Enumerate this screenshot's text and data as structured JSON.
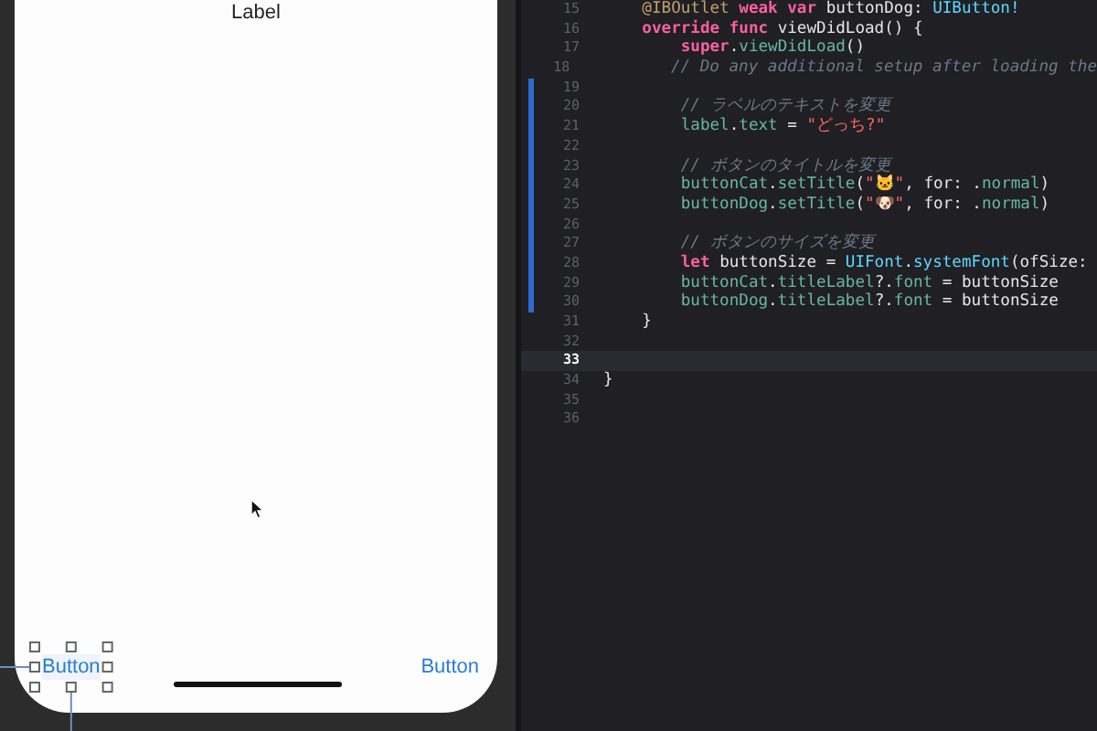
{
  "canvas": {
    "label": "Label",
    "buttons": [
      {
        "title": "Button",
        "selected": true
      },
      {
        "title": "Button",
        "selected": false
      }
    ]
  },
  "editor": {
    "lines": [
      {
        "number": "15",
        "current": false,
        "changed": false,
        "tokens": [
          {
            "kind": "attr",
            "text": "    @IBOutlet "
          },
          {
            "kind": "keyword",
            "text": "weak var "
          },
          {
            "kind": "plain",
            "text": "buttonDog: "
          },
          {
            "kind": "type",
            "text": "UIButton!"
          }
        ]
      },
      {
        "number": "16",
        "current": false,
        "changed": false,
        "tokens": [
          {
            "kind": "keyword",
            "text": "    override func "
          },
          {
            "kind": "plain",
            "text": "viewDidLoad() {"
          }
        ]
      },
      {
        "number": "17",
        "current": false,
        "changed": false,
        "tokens": [
          {
            "kind": "keyword",
            "text": "        super"
          },
          {
            "kind": "plain",
            "text": "."
          },
          {
            "kind": "project",
            "text": "viewDidLoad"
          },
          {
            "kind": "plain",
            "text": "()"
          }
        ]
      },
      {
        "number": "18",
        "current": false,
        "changed": false,
        "tokens": [
          {
            "kind": "comment",
            "text": "        // Do any additional setup after loading the"
          }
        ]
      },
      {
        "number": "19",
        "current": false,
        "changed": true
      },
      {
        "number": "20",
        "current": false,
        "changed": true,
        "tokens": [
          {
            "kind": "comment",
            "text": "        // ラベルのテキストを変更"
          }
        ]
      },
      {
        "number": "21",
        "current": false,
        "changed": true,
        "tokens": [
          {
            "kind": "project",
            "text": "        label"
          },
          {
            "kind": "plain",
            "text": "."
          },
          {
            "kind": "project",
            "text": "text"
          },
          {
            "kind": "plain",
            "text": " = "
          },
          {
            "kind": "string",
            "text": "\"どっち?\""
          }
        ]
      },
      {
        "number": "22",
        "current": false,
        "changed": true
      },
      {
        "number": "23",
        "current": false,
        "changed": true,
        "tokens": [
          {
            "kind": "comment",
            "text": "        // ボタンのタイトルを変更"
          }
        ]
      },
      {
        "number": "24",
        "current": false,
        "changed": true,
        "tokens": [
          {
            "kind": "project",
            "text": "        buttonCat"
          },
          {
            "kind": "plain",
            "text": "."
          },
          {
            "kind": "project",
            "text": "setTitle"
          },
          {
            "kind": "plain",
            "text": "("
          },
          {
            "kind": "string",
            "text": "\"🐱\""
          },
          {
            "kind": "plain",
            "text": ", for: ."
          },
          {
            "kind": "project",
            "text": "normal"
          },
          {
            "kind": "plain",
            "text": ")"
          }
        ]
      },
      {
        "number": "25",
        "current": false,
        "changed": true,
        "tokens": [
          {
            "kind": "project",
            "text": "        buttonDog"
          },
          {
            "kind": "plain",
            "text": "."
          },
          {
            "kind": "project",
            "text": "setTitle"
          },
          {
            "kind": "plain",
            "text": "("
          },
          {
            "kind": "string",
            "text": "\"🐶\""
          },
          {
            "kind": "plain",
            "text": ", for: ."
          },
          {
            "kind": "project",
            "text": "normal"
          },
          {
            "kind": "plain",
            "text": ")"
          }
        ]
      },
      {
        "number": "26",
        "current": false,
        "changed": true
      },
      {
        "number": "27",
        "current": false,
        "changed": true,
        "tokens": [
          {
            "kind": "comment",
            "text": "        // ボタンのサイズを変更"
          }
        ]
      },
      {
        "number": "28",
        "current": false,
        "changed": true,
        "tokens": [
          {
            "kind": "keyword",
            "text": "        let "
          },
          {
            "kind": "plain",
            "text": "buttonSize = "
          },
          {
            "kind": "type",
            "text": "UIFont"
          },
          {
            "kind": "plain",
            "text": "."
          },
          {
            "kind": "type",
            "text": "systemFont"
          },
          {
            "kind": "plain",
            "text": "(ofSize:"
          }
        ]
      },
      {
        "number": "29",
        "current": false,
        "changed": true,
        "tokens": [
          {
            "kind": "project",
            "text": "        buttonCat"
          },
          {
            "kind": "plain",
            "text": "."
          },
          {
            "kind": "project",
            "text": "titleLabel"
          },
          {
            "kind": "plain",
            "text": "?."
          },
          {
            "kind": "project",
            "text": "font"
          },
          {
            "kind": "plain",
            "text": " = buttonSize"
          }
        ]
      },
      {
        "number": "30",
        "current": false,
        "changed": true,
        "tokens": [
          {
            "kind": "project",
            "text": "        buttonDog"
          },
          {
            "kind": "plain",
            "text": "."
          },
          {
            "kind": "project",
            "text": "titleLabel"
          },
          {
            "kind": "plain",
            "text": "?."
          },
          {
            "kind": "project",
            "text": "font"
          },
          {
            "kind": "plain",
            "text": " = buttonSize"
          }
        ]
      },
      {
        "number": "31",
        "current": false,
        "changed": false,
        "tokens": [
          {
            "kind": "plain",
            "text": "    }"
          }
        ]
      },
      {
        "number": "32",
        "current": false,
        "changed": false
      },
      {
        "number": "33",
        "current": true,
        "changed": false
      },
      {
        "number": "34",
        "current": false,
        "changed": false,
        "tokens": [
          {
            "kind": "plain",
            "text": "}"
          }
        ]
      },
      {
        "number": "35",
        "current": false,
        "changed": false
      },
      {
        "number": "36",
        "current": false,
        "changed": false
      }
    ]
  }
}
